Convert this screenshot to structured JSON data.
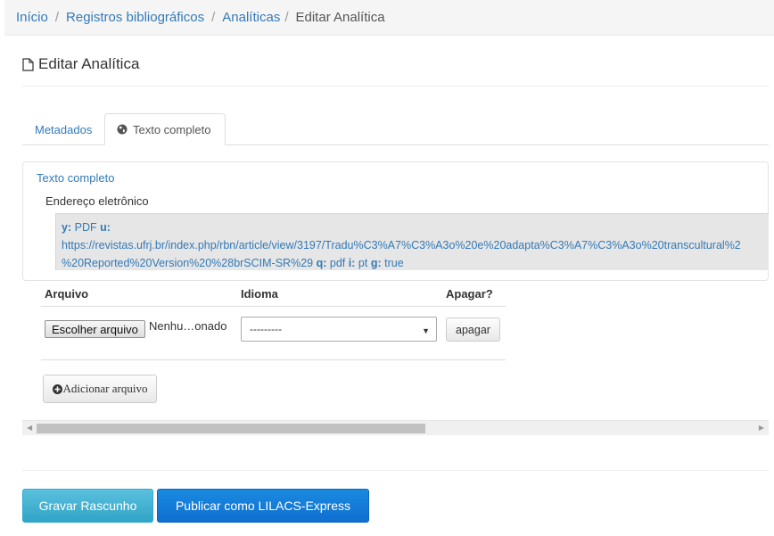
{
  "breadcrumb": {
    "items": [
      "Início",
      "Registros bibliográficos",
      "Analíticas"
    ],
    "separator": "/",
    "active": "Editar Analítica"
  },
  "page": {
    "title": "Editar Analítica",
    "icon": "file-icon"
  },
  "tabs": [
    {
      "label": "Metadados",
      "active": false
    },
    {
      "label": "Texto completo",
      "active": true,
      "icon": "globe-icon"
    }
  ],
  "panel": {
    "title": "Texto completo",
    "field_label": "Endereço eletrônico",
    "value_lines": {
      "line1_key_y": "y:",
      "line1_val_y": "PDF",
      "line1_key_u": "u:",
      "line2": "https://revistas.ufrj.br/index.php/rbn/article/view/3197/Tradu%C3%A7%C3%A3o%20e%20adapta%C3%A7%C3%A3o%20transcultural%2",
      "line3_text": "%20Reported%20Version%20%28brSCIM-SR%29",
      "line3_key_q": "q:",
      "line3_val_q": "pdf",
      "line3_key_i": "i:",
      "line3_val_i": "pt",
      "line3_key_g": "g:",
      "line3_val_g": "true"
    }
  },
  "files_table": {
    "headers": [
      "Arquivo",
      "Idioma",
      "Apagar?"
    ],
    "row": {
      "file_button": "Escolher arquivo",
      "file_status": "Nenhu…onado",
      "language_selected": "---------",
      "delete_button": "apagar"
    },
    "add_button": "Adicionar arquivo"
  },
  "actions": {
    "draft": "Gravar Rascunho",
    "publish": "Publicar como LILACS-Express"
  },
  "colors": {
    "link": "#337ab7",
    "draft_button": "#31a4c6",
    "publish_button": "#0f6fd0"
  }
}
